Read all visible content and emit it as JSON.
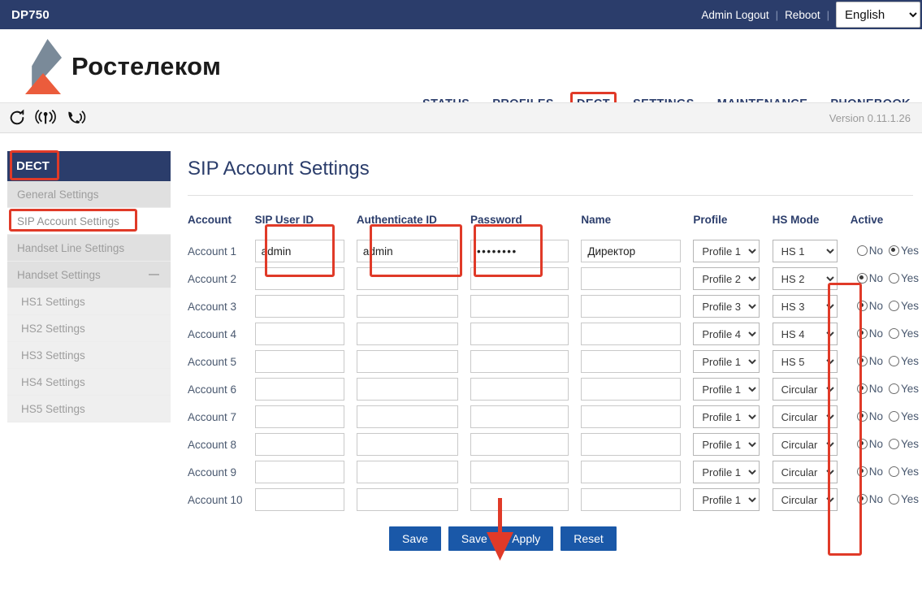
{
  "topbar": {
    "device_name": "DP750",
    "logout_label": "Admin Logout",
    "reboot_label": "Reboot",
    "separator": "|",
    "language_selected": "English",
    "language_options": [
      "English"
    ]
  },
  "brand": {
    "logo_text": "Ростелеком",
    "logo_gray": "#7a8a99",
    "logo_orange": "#eb5c3c"
  },
  "nav": {
    "items": [
      {
        "label": "STATUS",
        "highlighted": false
      },
      {
        "label": "PROFILES",
        "highlighted": false
      },
      {
        "label": "DECT",
        "highlighted": true
      },
      {
        "label": "SETTINGS",
        "highlighted": false
      },
      {
        "label": "MAINTENANCE",
        "highlighted": false
      },
      {
        "label": "PHONEBOOK",
        "highlighted": false
      }
    ]
  },
  "statusbar": {
    "icons": [
      "refresh-icon",
      "antenna-signal-icon",
      "phone-ringing-icon"
    ],
    "version": "Version 0.11.1.26"
  },
  "sidebar": {
    "header": "DECT",
    "items": [
      {
        "label": "General Settings",
        "selected": false,
        "sub": false,
        "highlighted": false
      },
      {
        "label": "SIP Account Settings",
        "selected": true,
        "sub": false,
        "highlighted": true
      },
      {
        "label": "Handset Line Settings",
        "selected": false,
        "sub": false,
        "highlighted": false
      },
      {
        "label": "Handset Settings",
        "selected": false,
        "sub": false,
        "highlighted": false,
        "collapse_icon": "minus-icon"
      },
      {
        "label": "HS1 Settings",
        "selected": false,
        "sub": true,
        "highlighted": false
      },
      {
        "label": "HS2 Settings",
        "selected": false,
        "sub": true,
        "highlighted": false
      },
      {
        "label": "HS3 Settings",
        "selected": false,
        "sub": true,
        "highlighted": false
      },
      {
        "label": "HS4 Settings",
        "selected": false,
        "sub": true,
        "highlighted": false
      },
      {
        "label": "HS5 Settings",
        "selected": false,
        "sub": true,
        "highlighted": false
      }
    ]
  },
  "main": {
    "page_title": "SIP Account Settings",
    "columns": {
      "account": "Account",
      "sip_user_id": "SIP User ID",
      "authenticate_id": "Authenticate ID",
      "password": "Password",
      "name": "Name",
      "profile": "Profile",
      "hs_mode": "HS Mode",
      "active": "Active"
    },
    "radio_labels": {
      "no": "No",
      "yes": "Yes"
    },
    "profile_options": [
      "Profile 1",
      "Profile 2",
      "Profile 3",
      "Profile 4"
    ],
    "hs_mode_options": [
      "HS 1",
      "HS 2",
      "HS 3",
      "HS 4",
      "HS 5",
      "Circular"
    ],
    "rows": [
      {
        "account": "Account 1",
        "sip_user_id": "admin",
        "authenticate_id": "admin",
        "password": "••••••••",
        "name": "Директор",
        "profile": "Profile 1",
        "hs_mode": "HS 1",
        "active": "Yes"
      },
      {
        "account": "Account 2",
        "sip_user_id": "",
        "authenticate_id": "",
        "password": "",
        "name": "",
        "profile": "Profile 2",
        "hs_mode": "HS 2",
        "active": "No"
      },
      {
        "account": "Account 3",
        "sip_user_id": "",
        "authenticate_id": "",
        "password": "",
        "name": "",
        "profile": "Profile 3",
        "hs_mode": "HS 3",
        "active": "No"
      },
      {
        "account": "Account 4",
        "sip_user_id": "",
        "authenticate_id": "",
        "password": "",
        "name": "",
        "profile": "Profile 4",
        "hs_mode": "HS 4",
        "active": "No"
      },
      {
        "account": "Account 5",
        "sip_user_id": "",
        "authenticate_id": "",
        "password": "",
        "name": "",
        "profile": "Profile 1",
        "hs_mode": "HS 5",
        "active": "No"
      },
      {
        "account": "Account 6",
        "sip_user_id": "",
        "authenticate_id": "",
        "password": "",
        "name": "",
        "profile": "Profile 1",
        "hs_mode": "Circular",
        "active": "No"
      },
      {
        "account": "Account 7",
        "sip_user_id": "",
        "authenticate_id": "",
        "password": "",
        "name": "",
        "profile": "Profile 1",
        "hs_mode": "Circular",
        "active": "No"
      },
      {
        "account": "Account 8",
        "sip_user_id": "",
        "authenticate_id": "",
        "password": "",
        "name": "",
        "profile": "Profile 1",
        "hs_mode": "Circular",
        "active": "No"
      },
      {
        "account": "Account 9",
        "sip_user_id": "",
        "authenticate_id": "",
        "password": "",
        "name": "",
        "profile": "Profile 1",
        "hs_mode": "Circular",
        "active": "No"
      },
      {
        "account": "Account 10",
        "sip_user_id": "",
        "authenticate_id": "",
        "password": "",
        "name": "",
        "profile": "Profile 1",
        "hs_mode": "Circular",
        "active": "No"
      }
    ],
    "buttons": {
      "save": "Save",
      "save_and_apply": "Save and Apply",
      "reset": "Reset"
    }
  },
  "annotations": {
    "color": "#e03a28",
    "arrow": "down-arrow"
  }
}
